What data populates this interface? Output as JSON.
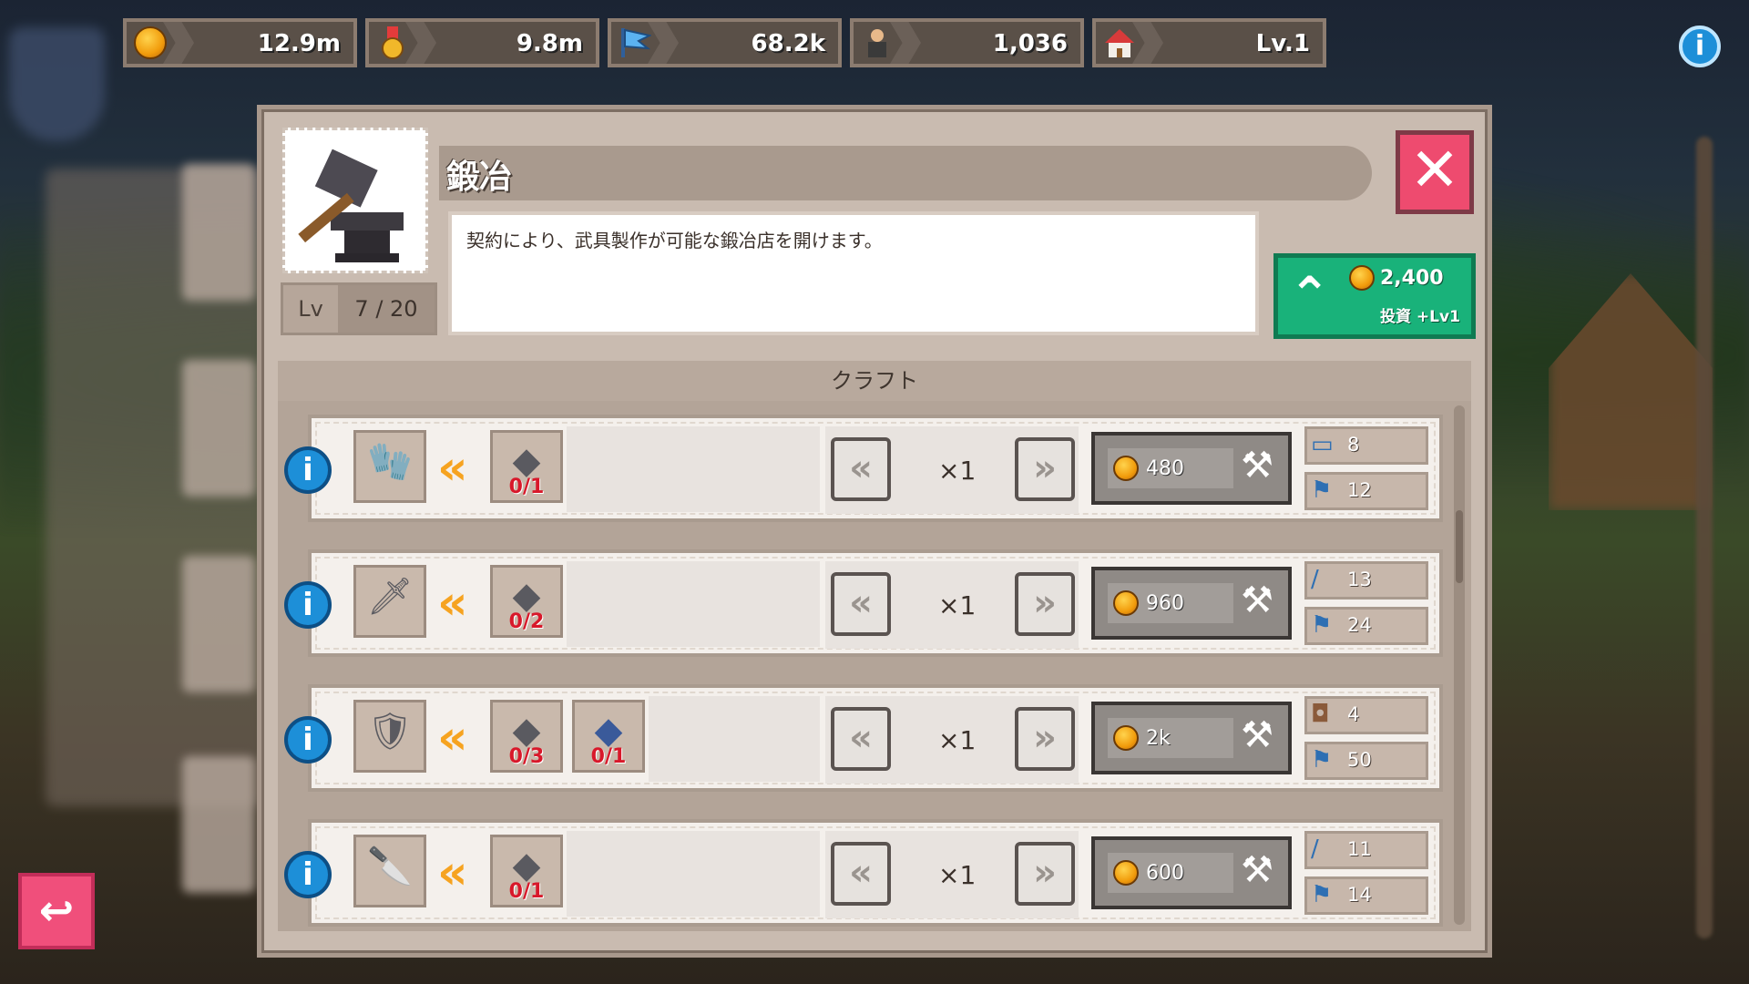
{
  "resources": [
    {
      "name": "gold",
      "value": "12.9m"
    },
    {
      "name": "medal",
      "value": "9.8m"
    },
    {
      "name": "flag",
      "value": "68.2k"
    },
    {
      "name": "population",
      "value": "1,036"
    },
    {
      "name": "house",
      "value": "Lv.1"
    }
  ],
  "info_top": {
    "label": "i"
  },
  "back_button": {
    "label": "↩"
  },
  "panel": {
    "title": "鍛冶",
    "description": "契約により、武具製作が可能な鍛冶店を開けます。",
    "level_label": "Lv",
    "level_value": "7 / 20",
    "close_label": "✕",
    "invest": {
      "cost": "2,400",
      "label": "投資 +Lv1"
    },
    "craft_header": "クラフト"
  },
  "craft_rows": [
    {
      "item": "gauntlet",
      "materials": [
        {
          "name": "iron-ore",
          "count": "0/1"
        }
      ],
      "qty": "×1",
      "cost": "480",
      "reward_item": "8",
      "reward_flag": "12"
    },
    {
      "item": "sword",
      "materials": [
        {
          "name": "iron-ore",
          "count": "0/2"
        }
      ],
      "qty": "×1",
      "cost": "960",
      "reward_item": "13",
      "reward_flag": "24"
    },
    {
      "item": "shield",
      "materials": [
        {
          "name": "iron-ore",
          "count": "0/3"
        },
        {
          "name": "blue-ore",
          "count": "0/1"
        }
      ],
      "qty": "×1",
      "cost": "2k",
      "reward_item": "4",
      "reward_flag": "50"
    },
    {
      "item": "dagger",
      "materials": [
        {
          "name": "iron-ore",
          "count": "0/1"
        }
      ],
      "qty": "×1",
      "cost": "600",
      "reward_item": "11",
      "reward_flag": "14"
    }
  ],
  "colors": {
    "accent_green": "#19b27a",
    "close_red": "#ee4b6f",
    "info_blue": "#1d8fd8",
    "arrow_orange": "#f6a320",
    "count_red": "#d8182a"
  }
}
